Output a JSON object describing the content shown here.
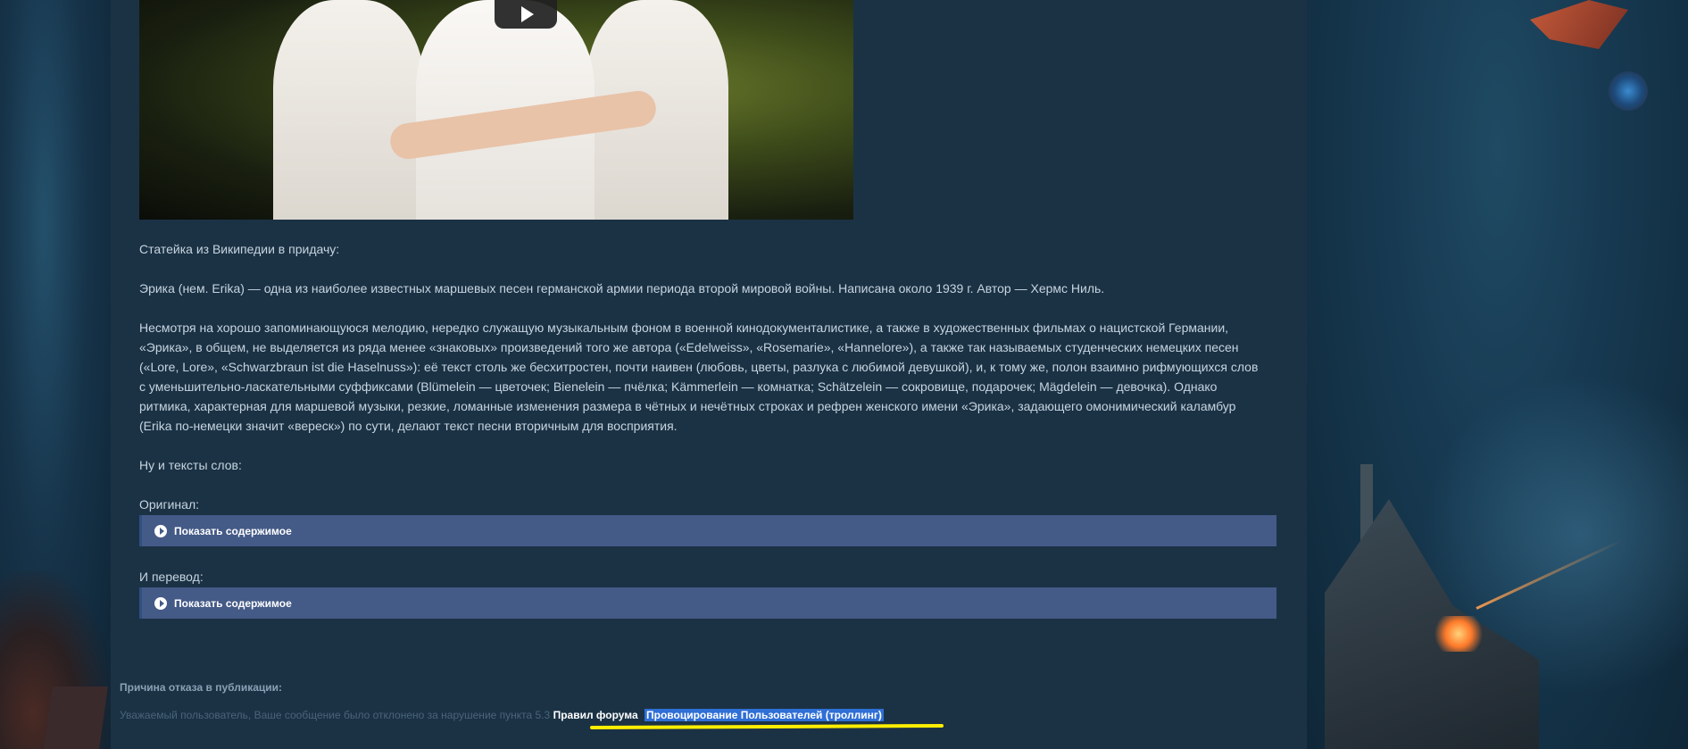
{
  "post": {
    "intro": "Статейка из Википедии в придачу:",
    "wiki_paragraph_1": "Эрика (нем. Erika) — одна из наиболее известных маршевых песен германской армии периода второй мировой войны. Написана около 1939 г. Автор — Хермс Ниль.",
    "wiki_paragraph_2": "Несмотря на хорошо запоминающуюся мелодию, нередко служащую музыкальным фоном в военной кинодокументалистике, а также в художественных фильмах о нацистской Германии, «Эрика», в общем, не выделяется из ряда менее «знаковых» произведений того же автора («Edelweiss», «Rosemarie», «Hannelore»), а также так называемых студенческих немецких песен («Lore, Lore», «Schwarzbraun ist die Haselnuss»): её текст столь же бесхитростен, почти наивен (любовь, цветы, разлука с любимой девушкой), и, к тому же, полон взаимно рифмующихся слов с уменьшительно-ласкательными суффиксами (Blümelein — цветочек; Bienelein — пчёлка; Kämmerlein — комнатка; Schätzelein — сокровище, подарочек; Mägdelein — девочка). Однако ритмика, характерная для маршевой музыки, резкие, ломанные изменения размера в чётных и нечётных строках и рефрен женского имени «Эрика», задающего омонимический каламбур (Erika по-немецки значит «вереск») по сути, делают текст песни вторичным для восприятия.",
    "lyrics_intro": "Ну и тексты слов:",
    "original_label": "Оригинал:",
    "translation_label": "И перевод:",
    "spoiler_label": "Показать содержимое"
  },
  "moderation": {
    "reason_title": "Причина отказа в публикации:",
    "reason_text": "Уважаемый пользователь, Ваше сообщение было отклонено за нарушение пункта 5.3",
    "rules_link": "Правил форума",
    "highlighted_rule": "Провоцирование Пользователей (троллинг)"
  },
  "icons": {
    "play": "play-icon",
    "spoiler": "chevron-right-circle-icon"
  },
  "colors": {
    "page_bg": "#1b3245",
    "text": "#c6d4df",
    "spoiler_bg": "#445a87",
    "highlight": "#2f6fd6",
    "annotation": "#ffee00"
  }
}
